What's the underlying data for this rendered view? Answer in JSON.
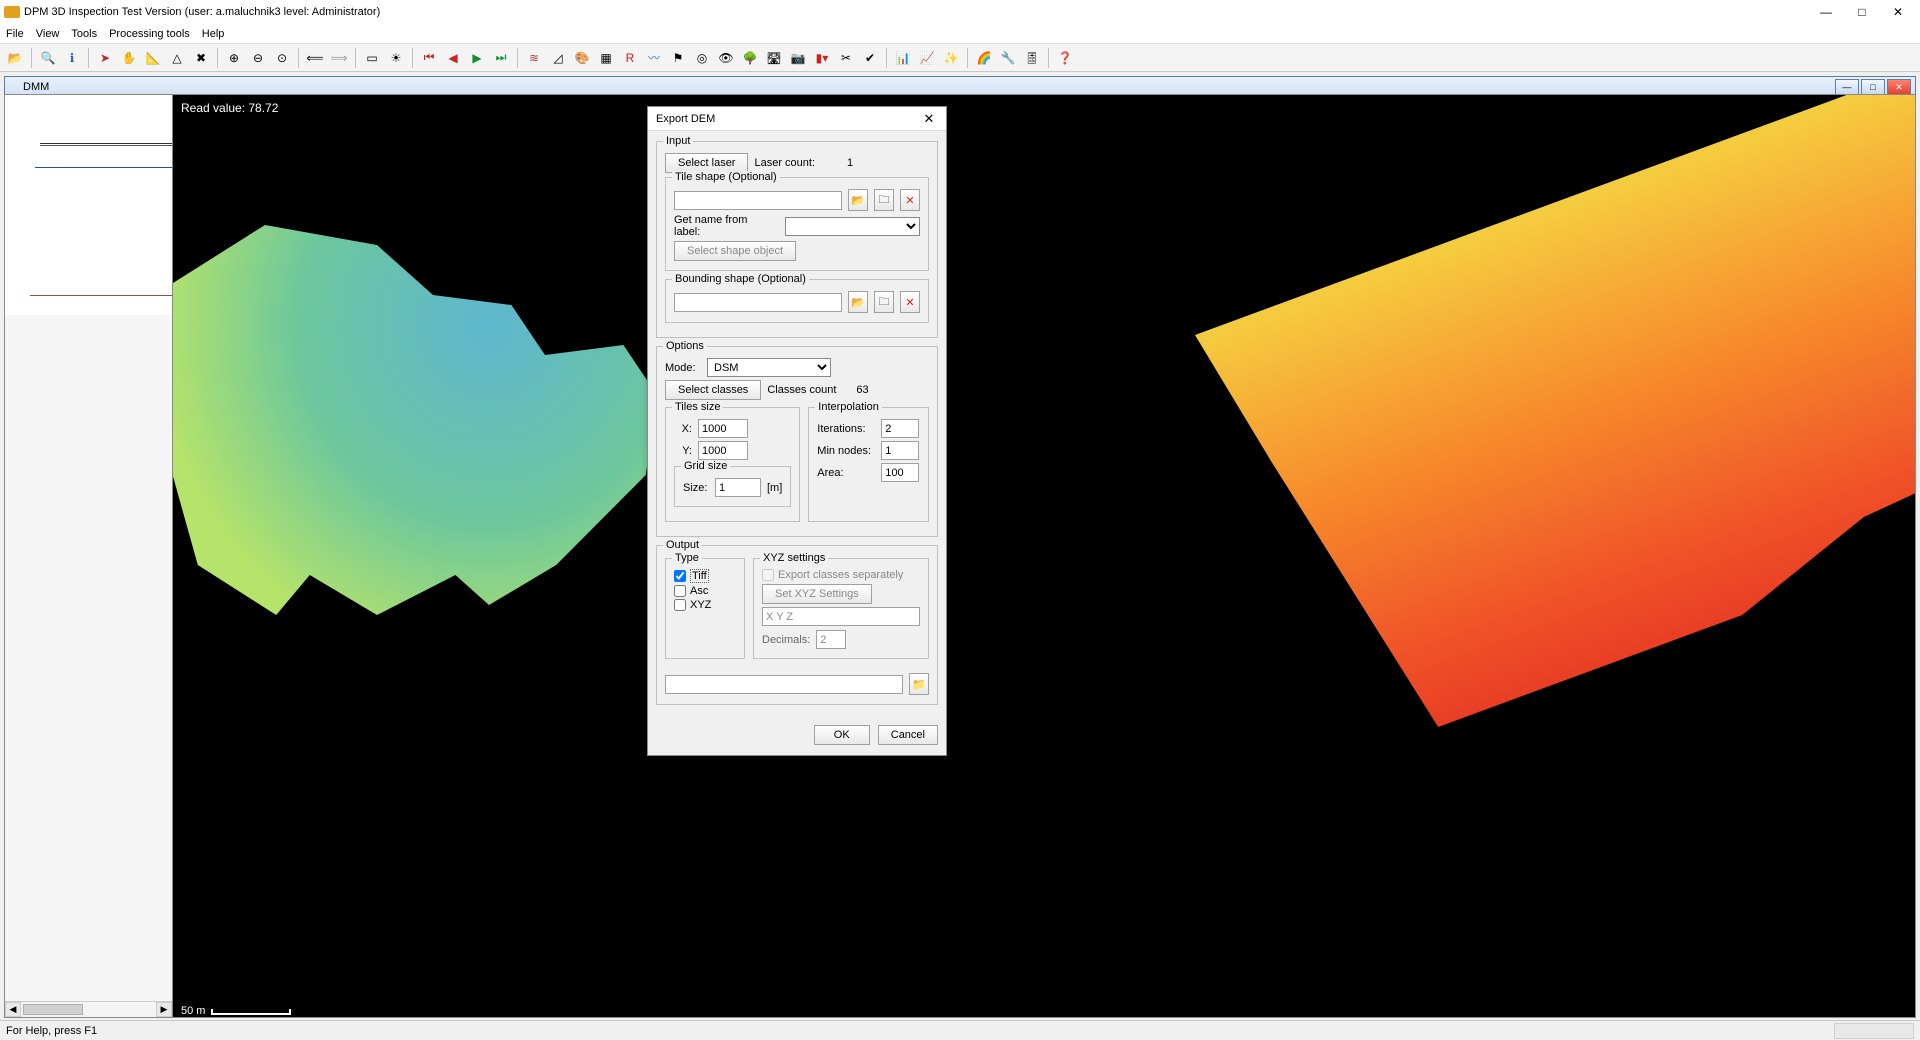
{
  "window": {
    "title": "DPM 3D Inspection Test Version (user: a.maluchnik3 level: Administrator)"
  },
  "menu": {
    "items": [
      "File",
      "View",
      "Tools",
      "Processing tools",
      "Help"
    ]
  },
  "subwindow": {
    "title": "DMM"
  },
  "viewport": {
    "readout": "Read value: 78.72",
    "scale_label": "50 m"
  },
  "dialog": {
    "title": "Export DEM",
    "input_group": "Input",
    "select_laser_btn": "Select laser",
    "laser_count_label": "Laser count:",
    "laser_count_value": "1",
    "tile_shape_group": "Tile shape (Optional)",
    "get_name_label": "Get name from label:",
    "select_shape_btn": "Select shape object",
    "bounding_group": "Bounding shape (Optional)",
    "options_group": "Options",
    "mode_label": "Mode:",
    "mode_value": "DSM",
    "select_classes_btn": "Select classes",
    "classes_count_label": "Classes count",
    "classes_count_value": "63",
    "tiles_size_group": "Tiles size",
    "x_label": "X:",
    "x_value": "1000",
    "y_label": "Y:",
    "y_value": "1000",
    "grid_size_group": "Grid size",
    "size_label": "Size:",
    "size_value": "1",
    "size_unit": "[m]",
    "interp_group": "Interpolation",
    "iterations_label": "Iterations:",
    "iterations_value": "2",
    "min_nodes_label": "Min nodes:",
    "min_nodes_value": "1",
    "area_label": "Area:",
    "area_value": "100",
    "output_group": "Output",
    "type_group": "Type",
    "type_tiff": "Tiff",
    "type_asc": "Asc",
    "type_xyz": "XYZ",
    "xyz_group": "XYZ settings",
    "export_classes_label": "Export classes separately",
    "set_xyz_btn": "Set XYZ Settings",
    "xyz_placeholder": "X Y Z",
    "decimals_label": "Decimals:",
    "decimals_value": "2",
    "ok_btn": "OK",
    "cancel_btn": "Cancel"
  },
  "status": {
    "help_text": "For Help, press F1"
  }
}
